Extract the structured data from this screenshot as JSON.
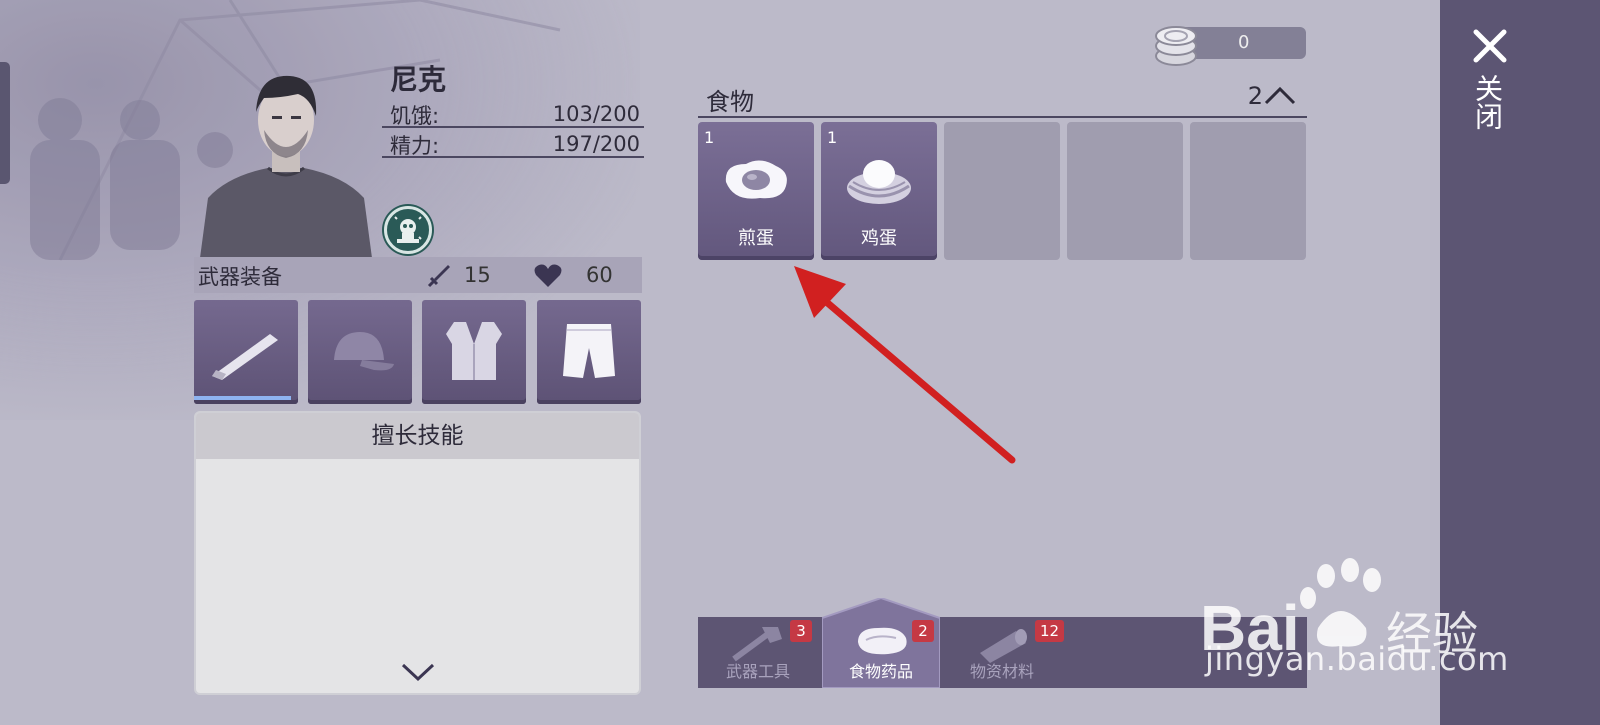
{
  "character": {
    "name": "尼克",
    "stats": [
      {
        "label": "饥饿:",
        "value": "103/200"
      },
      {
        "label": "精力:",
        "value": "197/200"
      }
    ]
  },
  "equipment": {
    "title": "武器装备",
    "attack": "15",
    "health": "60",
    "slots": [
      "machete-icon",
      "cap-icon",
      "vest-icon",
      "shorts-icon"
    ],
    "weapon_durability": 0.93
  },
  "skills": {
    "title": "擅长技能"
  },
  "currency": {
    "value": "0",
    "icon": "coin-stack-icon"
  },
  "food": {
    "title": "食物",
    "count": "2",
    "items": [
      {
        "qty": "1",
        "name": "煎蛋",
        "icon": "fried-egg-icon"
      },
      {
        "qty": "1",
        "name": "鸡蛋",
        "icon": "egg-nest-icon"
      }
    ],
    "empty_slots": 3
  },
  "tabs": [
    {
      "label": "武器工具",
      "badge": "3",
      "icon": "axe-hammer-icon",
      "active": false
    },
    {
      "label": "食物药品",
      "badge": "2",
      "icon": "meat-icon",
      "active": true
    },
    {
      "label": "物资材料",
      "badge": "12",
      "icon": "log-icon",
      "active": false
    }
  ],
  "close": {
    "label": "关闭"
  },
  "watermark": {
    "url": "jingyan.baidu.com"
  },
  "colors": {
    "panel": "#5c5573",
    "slot": "#6e628a",
    "badge": "#c53944",
    "accent": "#d12020"
  }
}
